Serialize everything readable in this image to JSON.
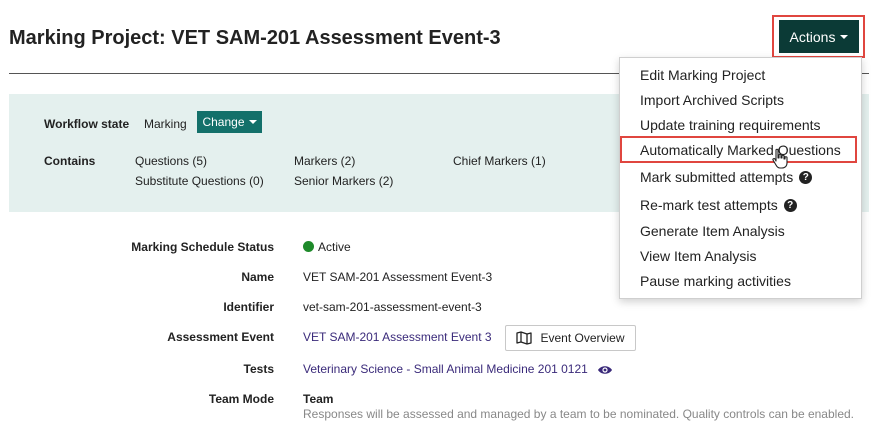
{
  "header": {
    "title": "Marking Project: VET SAM-201 Assessment Event-3",
    "actions_label": "Actions"
  },
  "workflow": {
    "state_label": "Workflow state",
    "state_value": "Marking",
    "change_label": "Change",
    "contains_label": "Contains",
    "contains": {
      "questions": "Questions (5)",
      "substitute_questions": "Substitute Questions (0)",
      "markers": "Markers (2)",
      "senior_markers": "Senior Markers (2)",
      "chief_markers": "Chief Markers (1)"
    }
  },
  "details": {
    "schedule_status_label": "Marking Schedule Status",
    "schedule_status_value": "Active",
    "name_label": "Name",
    "name_value": "VET SAM-201 Assessment Event-3",
    "identifier_label": "Identifier",
    "identifier_value": "vet-sam-201-assessment-event-3",
    "assessment_event_label": "Assessment Event",
    "assessment_event_value": "VET SAM-201 Assessment Event 3",
    "event_overview_label": "Event Overview",
    "tests_label": "Tests",
    "tests_value": "Veterinary Science - Small Animal Medicine 201 0121",
    "team_mode_label": "Team Mode",
    "team_mode_value": "Team",
    "team_mode_description": "Responses will be assessed and managed by a team to be nominated. Quality controls can be enabled."
  },
  "actions_menu": {
    "items": [
      "Edit Marking Project",
      "Import Archived Scripts",
      "Update training requirements",
      "Automatically Marked Questions",
      "Mark submitted attempts",
      "Re-mark test attempts",
      "Generate Item Analysis",
      "View Item Analysis",
      "Pause marking activities"
    ]
  },
  "colors": {
    "actions_button": "#0b3a36",
    "change_button": "#13706a",
    "panel_background": "#e4f0ee",
    "highlight_border": "#e0463f",
    "active_status": "#1e8a2a",
    "link": "#3a2a7a"
  }
}
